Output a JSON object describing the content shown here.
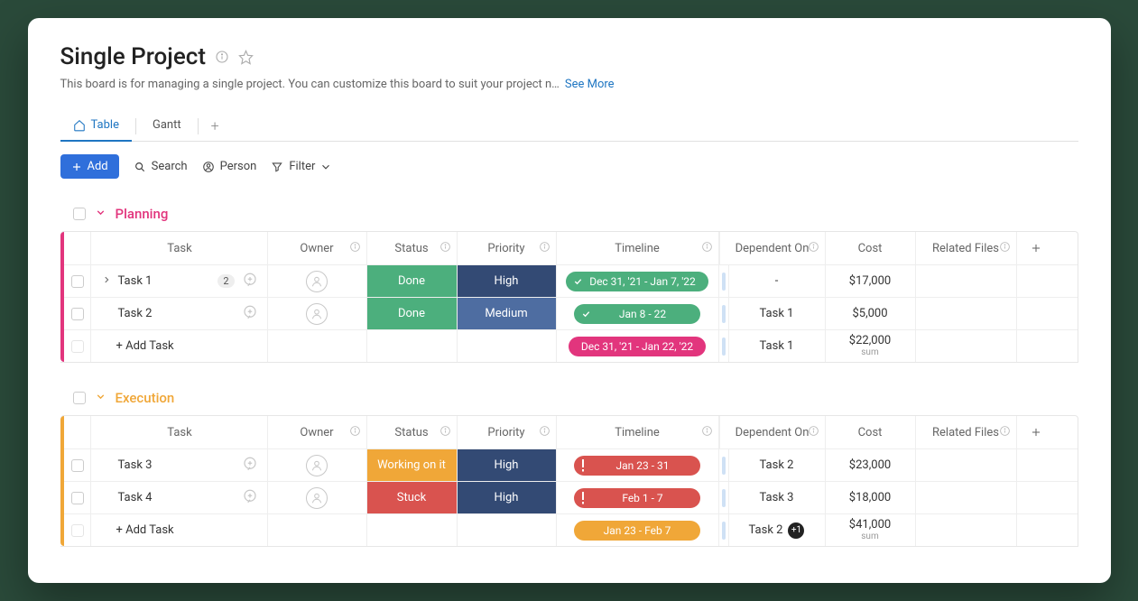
{
  "header": {
    "title": "Single Project",
    "description": "This board is for managing a single project. You can customize this board to suit your project n…",
    "see_more": "See More"
  },
  "tabs": {
    "table": "Table",
    "gantt": "Gantt"
  },
  "toolbar": {
    "add": "Add",
    "search": "Search",
    "person": "Person",
    "filter": "Filter"
  },
  "columns": {
    "task": "Task",
    "owner": "Owner",
    "status": "Status",
    "priority": "Priority",
    "timeline": "Timeline",
    "dependent": "Dependent On",
    "cost": "Cost",
    "files": "Related Files"
  },
  "groups": [
    {
      "id": "planning",
      "title": "Planning",
      "rows": [
        {
          "task": "Task 1",
          "subcount": "2",
          "expandable": true,
          "status": "Done",
          "statusClass": "status-done",
          "priority": "High",
          "prioClass": "prio-high",
          "timeline": "Dec 31, '21 - Jan 7, '22",
          "pillClass": "pill-green",
          "pillIcon": "check",
          "dependent": "-",
          "cost": "$17,000"
        },
        {
          "task": "Task 2",
          "status": "Done",
          "statusClass": "status-done",
          "priority": "Medium",
          "prioClass": "prio-medium",
          "timeline": "Jan 8 - 22",
          "pillClass": "pill-green",
          "pillIcon": "check",
          "dependent": "Task 1",
          "cost": "$5,000"
        }
      ],
      "footer": {
        "add_task": "+ Add Task",
        "timeline": "Dec 31, '21 - Jan 22, '22",
        "pillClass": "pill-pink",
        "dependent": "Task 1",
        "cost": "$22,000",
        "cost_label": "sum"
      }
    },
    {
      "id": "execution",
      "title": "Execution",
      "rows": [
        {
          "task": "Task 3",
          "status": "Working on it",
          "statusClass": "status-working",
          "priority": "High",
          "prioClass": "prio-high",
          "timeline": "Jan 23 - 31",
          "pillClass": "pill-red",
          "pillIcon": "alert",
          "dependent": "Task 2",
          "cost": "$23,000"
        },
        {
          "task": "Task 4",
          "status": "Stuck",
          "statusClass": "status-stuck",
          "priority": "High",
          "prioClass": "prio-high",
          "timeline": "Feb 1 - 7",
          "pillClass": "pill-red",
          "pillIcon": "alert",
          "dependent": "Task 3",
          "cost": "$18,000"
        }
      ],
      "footer": {
        "add_task": "+ Add Task",
        "timeline": "Jan 23 - Feb 7",
        "pillClass": "pill-orange",
        "dependent": "Task 2",
        "dep_extra": "+1",
        "cost": "$41,000",
        "cost_label": "sum"
      }
    }
  ]
}
